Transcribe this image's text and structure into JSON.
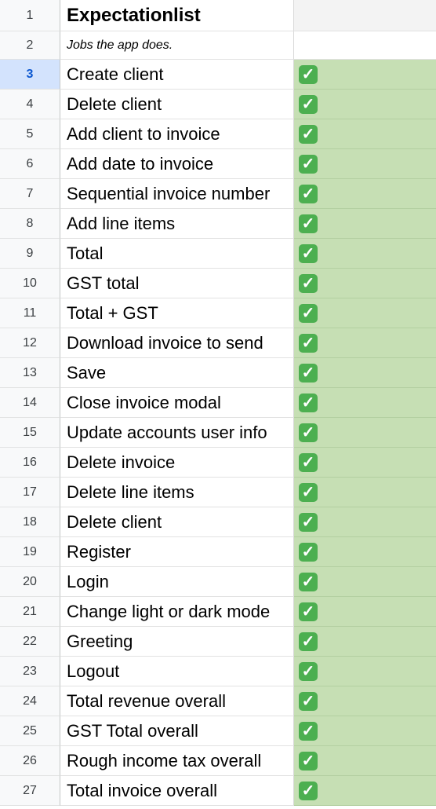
{
  "sheet": {
    "title": "Expectationlist",
    "subtitle": "Jobs the app does.",
    "rows": [
      {
        "num": "1"
      },
      {
        "num": "2"
      },
      {
        "num": "3",
        "label": "Create client",
        "done": true
      },
      {
        "num": "4",
        "label": "Delete client",
        "done": true
      },
      {
        "num": "5",
        "label": "Add client to invoice",
        "done": true
      },
      {
        "num": "6",
        "label": "Add date to invoice",
        "done": true
      },
      {
        "num": "7",
        "label": "Sequential invoice number",
        "done": true
      },
      {
        "num": "8",
        "label": "Add line items",
        "done": true
      },
      {
        "num": "9",
        "label": "Total",
        "done": true
      },
      {
        "num": "10",
        "label": "GST total",
        "done": true
      },
      {
        "num": "11",
        "label": "Total + GST",
        "done": true
      },
      {
        "num": "12",
        "label": "Download invoice to send",
        "done": true
      },
      {
        "num": "13",
        "label": "Save",
        "done": true
      },
      {
        "num": "14",
        "label": "Close invoice modal",
        "done": true
      },
      {
        "num": "15",
        "label": "Update accounts user info",
        "done": true
      },
      {
        "num": "16",
        "label": "Delete invoice",
        "done": true
      },
      {
        "num": "17",
        "label": "Delete line items",
        "done": true
      },
      {
        "num": "18",
        "label": "Delete client",
        "done": true
      },
      {
        "num": "19",
        "label": "Register",
        "done": true
      },
      {
        "num": "20",
        "label": "Login",
        "done": true
      },
      {
        "num": "21",
        "label": "Change light or dark mode",
        "done": true
      },
      {
        "num": "22",
        "label": "Greeting",
        "done": true
      },
      {
        "num": "23",
        "label": "Logout",
        "done": true
      },
      {
        "num": "24",
        "label": "Total revenue overall",
        "done": true
      },
      {
        "num": "25",
        "label": "GST Total overall",
        "done": true
      },
      {
        "num": "26",
        "label": "Rough income tax overall",
        "done": true
      },
      {
        "num": "27",
        "label": "Total invoice overall",
        "done": true
      }
    ],
    "selected_row": "3",
    "check_glyph": "✓",
    "colors": {
      "done_fill": "#c6dfb4",
      "check_badge": "#4caf50",
      "selected_row_header": "#d3e3fd"
    }
  }
}
